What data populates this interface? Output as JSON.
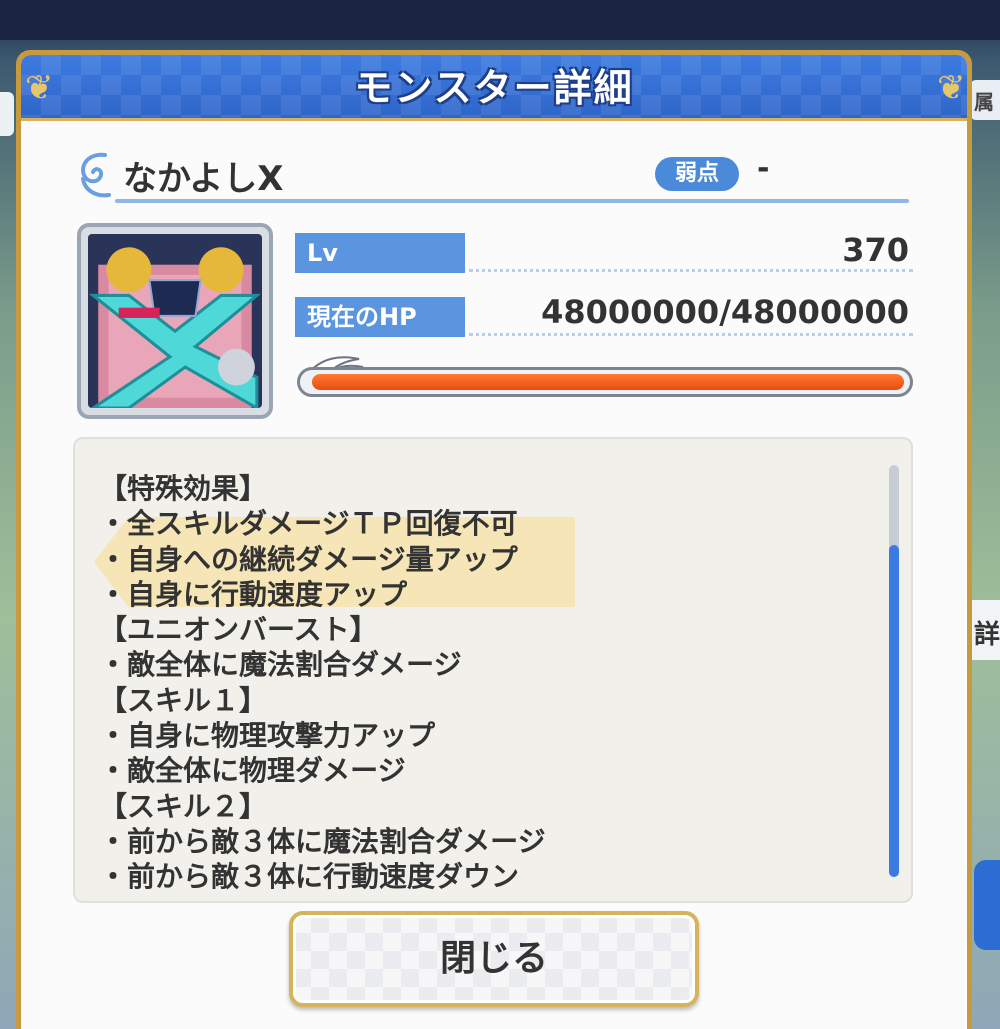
{
  "header": {
    "title": "モンスター詳細"
  },
  "monster": {
    "name": "なかよしX",
    "weakness_label": "弱点",
    "weakness_value": "-",
    "lv_label": "Lv",
    "lv_value": "370",
    "hp_label": "現在のHP",
    "hp_value": "48000000/48000000",
    "hp_fraction": 1.0
  },
  "description": {
    "lines": [
      "【特殊効果】",
      "・全スキルダメージＴＰ回復不可",
      "・自身への継続ダメージ量アップ",
      "・自身に行動速度アップ",
      "【ユニオンバースト】",
      "・敵全体に魔法割合ダメージ",
      "【スキル１】",
      "・自身に物理攻撃力アップ",
      "・敵全体に物理ダメージ",
      "【スキル２】",
      "・前から敵３体に魔法割合ダメージ",
      "・前から敵３体に行動速度ダウン"
    ]
  },
  "buttons": {
    "close_label": "閉じる"
  },
  "background": {
    "right_tab_top": "属性",
    "right_tab_mid": "詳"
  },
  "colors": {
    "accent": "#3d7be0",
    "hp_bar": "#e84d10",
    "frame_gold": "#c79a3d"
  }
}
